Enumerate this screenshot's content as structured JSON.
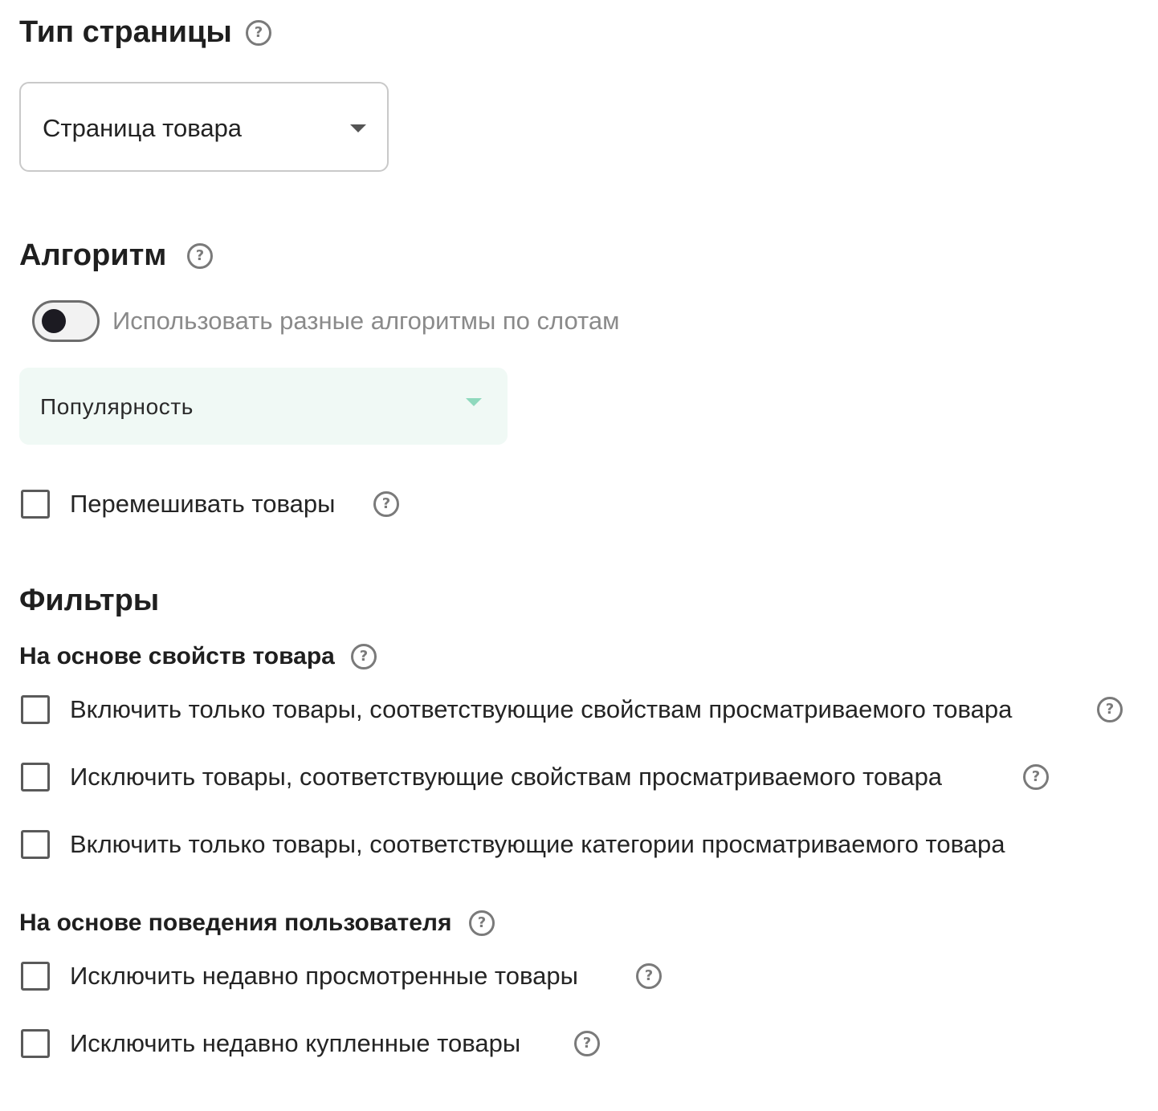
{
  "page_type": {
    "title": "Тип страницы",
    "help_icon": "question-circle-icon",
    "select": {
      "selected": "Страница товара",
      "caret_icon": "caret-down-icon"
    }
  },
  "algorithm": {
    "title": "Алгоритм",
    "help_icon": "question-circle-icon",
    "toggle": {
      "label": "Использовать разные алгоритмы по слотам",
      "checked": false
    },
    "select": {
      "selected": "Популярность",
      "caret_icon": "caret-down-icon",
      "accent_color": "#8fd9bd",
      "background_color": "#f0f9f5"
    },
    "shuffle": {
      "label": "Перемешивать товары",
      "checked": false
    }
  },
  "filters": {
    "title": "Фильтры",
    "product_properties": {
      "title": "На основе свойств товара",
      "items": [
        {
          "label": "Включить только товары, соответствующие свойствам просматриваемого товара",
          "checked": false,
          "has_help": true
        },
        {
          "label": "Исключить товары, соответствующие свойствам просматриваемого товара",
          "checked": false,
          "has_help": true
        },
        {
          "label": "Включить только товары, соответствующие категории просматриваемого товара",
          "checked": false,
          "has_help": false
        }
      ]
    },
    "user_behavior": {
      "title": "На основе поведения пользователя",
      "items": [
        {
          "label": "Исключить недавно просмотренные товары",
          "checked": false,
          "has_help": true
        },
        {
          "label": "Исключить недавно купленные товары",
          "checked": false,
          "has_help": true
        }
      ]
    }
  },
  "help_glyph": "?"
}
